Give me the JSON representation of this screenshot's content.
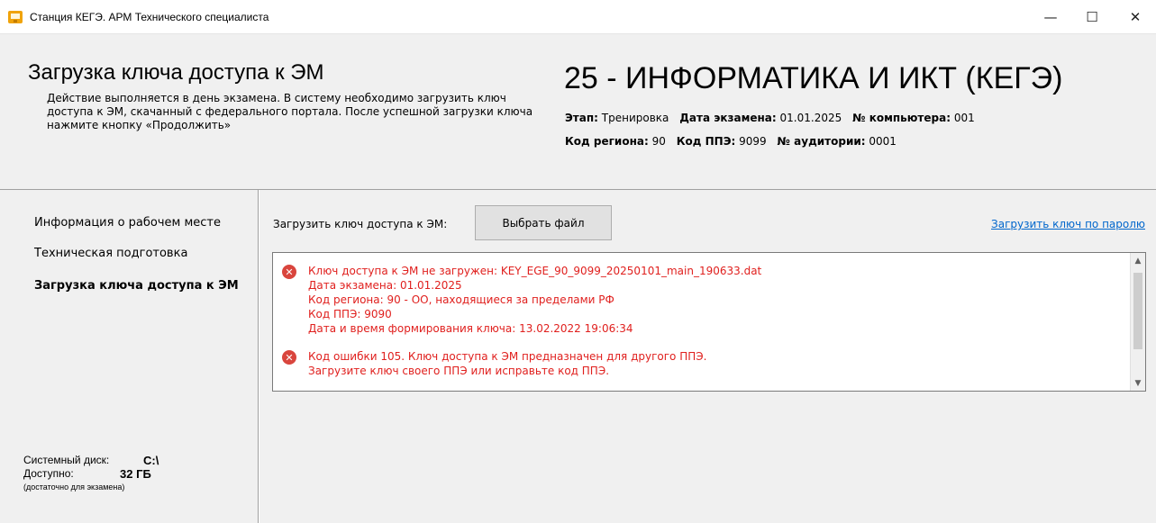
{
  "window": {
    "title": "Станция КЕГЭ. АРМ Технического специалиста",
    "minimize_glyph": "—",
    "maximize_glyph": "☐",
    "close_glyph": "✕"
  },
  "header": {
    "section_title": "Загрузка ключа доступа к ЭМ",
    "section_desc": "Действие выполняется в день экзамена. В систему необходимо загрузить ключ доступа к ЭМ, скачанный с федерального портала. После успешной загрузки ключа нажмите кнопку «Продолжить»",
    "subject_title": "25 - ИНФОРМАТИКА И ИКТ (КЕГЭ)",
    "meta": {
      "stage_label": "Этап:",
      "stage_value": "Тренировка",
      "exam_date_label": "Дата экзамена:",
      "exam_date_value": "01.01.2025",
      "computer_label": "№ компьютера:",
      "computer_value": "001",
      "region_label": "Код региона:",
      "region_value": "90",
      "ppe_label": "Код ППЭ:",
      "ppe_value": "9099",
      "room_label": "№ аудитории:",
      "room_value": "0001"
    }
  },
  "sidebar": {
    "items": [
      {
        "label": "Информация о рабочем месте",
        "active": false
      },
      {
        "label": "Техническая подготовка",
        "active": false
      },
      {
        "label": "Загрузка ключа доступа к ЭМ",
        "active": true
      }
    ],
    "disk": {
      "system_label": "Системный диск:",
      "system_value": "C:\\",
      "free_label": "Доступно:",
      "free_value": "32 ГБ",
      "note": "(достаточно для экзамена)"
    }
  },
  "main": {
    "load_label": "Загрузить ключ доступа к ЭМ:",
    "choose_button": "Выбрать файл",
    "password_link": "Загрузить ключ по паролю",
    "messages": [
      {
        "icon": "error-icon",
        "lines": [
          "Ключ доступа к ЭМ не загружен: KEY_EGE_90_9099_20250101_main_190633.dat",
          "Дата экзамена: 01.01.2025",
          "Код региона: 90 - ОО, находящиеся за пределами РФ",
          "Код ППЭ: 9090",
          "Дата и время формирования ключа: 13.02.2022 19:06:34"
        ]
      },
      {
        "icon": "error-icon",
        "lines": [
          "Код ошибки 105. Ключ доступа к ЭМ предназначен для другого ППЭ.",
          "Загрузите ключ своего ППЭ или исправьте код ППЭ."
        ]
      }
    ]
  },
  "colors": {
    "error_text": "#e0201e",
    "link": "#0066cc",
    "panel_bg": "#f0f0f0"
  }
}
